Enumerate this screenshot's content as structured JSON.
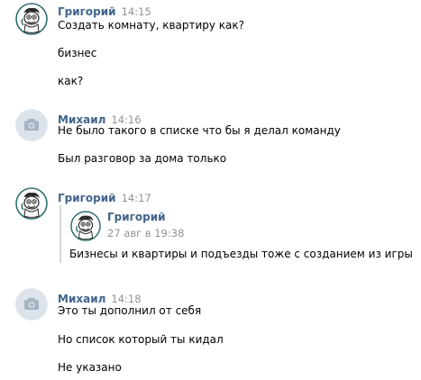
{
  "messages": [
    {
      "author": "Григорий",
      "time": "14:15",
      "lines": [
        "Создать комнату, квартиру как?",
        "бизнес",
        "как?"
      ]
    },
    {
      "author": "Михаил",
      "time": "14:16",
      "lines": [
        "Не было такого в списке что бы я делал команду",
        "Был разговор за дома только"
      ]
    },
    {
      "author": "Григорий",
      "time": "14:17",
      "forward": {
        "author": "Григорий",
        "date": "27 авг в 19:38",
        "text": "Бизнесы и квартиры и подъезды тоже с созданием из игры"
      }
    },
    {
      "author": "Михаил",
      "time": "14:18",
      "lines": [
        "Это ты дополнил от себя",
        "Но список который ты кидал",
        "Не указано"
      ]
    }
  ],
  "icons": {
    "grigoriy_avatar": "cartoon-character-avatar",
    "mikhail_avatar": "camera-placeholder-avatar"
  },
  "colors": {
    "author": "#42648b",
    "time": "#939393",
    "avatar_placeholder_bg": "#dde3ea",
    "avatar_placeholder_icon": "#a5b4c5",
    "quote_border": "#d3d9de"
  }
}
